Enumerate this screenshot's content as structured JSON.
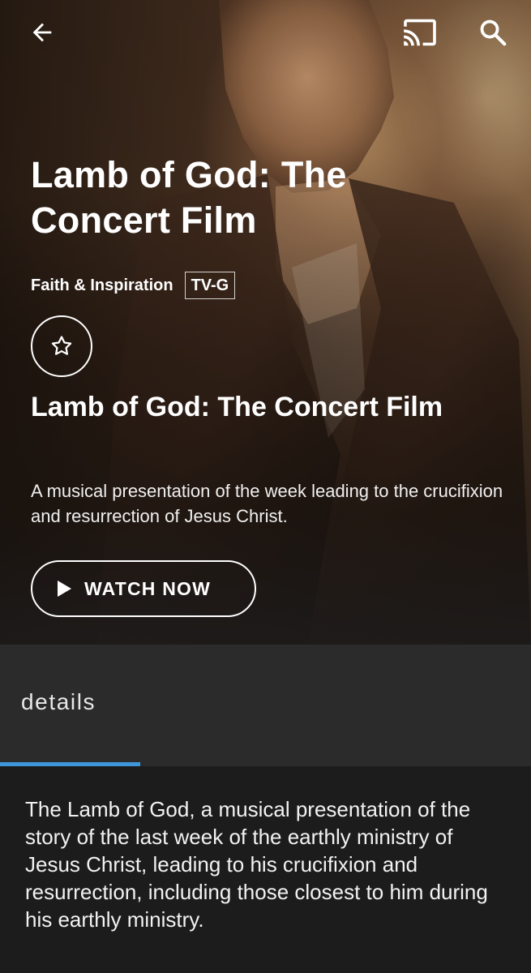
{
  "header": {
    "back_icon": "arrow-left-icon",
    "cast_icon": "cast-icon",
    "search_icon": "search-icon"
  },
  "show": {
    "title": "Lamb of God: The Concert Film",
    "genre": "Faith & Inspiration",
    "rating": "TV-G",
    "favorite_icon": "star-outline-icon",
    "subtitle": "Lamb of God: The Concert Film",
    "synopsis": "A musical presentation of the week leading to the crucifixion and resurrection of Jesus Christ."
  },
  "actions": {
    "watch_label": "WATCH NOW",
    "watch_icon": "play-icon"
  },
  "tabs": {
    "active": "details",
    "accent_color": "#3e97d9"
  },
  "details": {
    "description": "The Lamb of God, a musical presentation of the story of the last week of the earthly ministry of Jesus Christ, leading to his crucifixion and resurrection, including those closest to him during his earthly ministry."
  }
}
